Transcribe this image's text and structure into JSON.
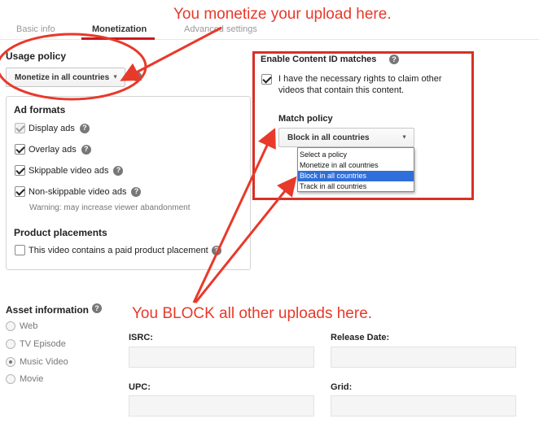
{
  "tabs": [
    {
      "label": "Basic info"
    },
    {
      "label": "Monetization"
    },
    {
      "label": "Advanced settings"
    }
  ],
  "usage_policy": {
    "title": "Usage policy",
    "selected": "Monetize in all countries"
  },
  "ad_formats": {
    "title": "Ad formats",
    "items": [
      {
        "label": "Display ads",
        "checked": true,
        "disabled": true
      },
      {
        "label": "Overlay ads",
        "checked": true
      },
      {
        "label": "Skippable video ads",
        "checked": true
      },
      {
        "label": "Non-skippable video ads",
        "checked": true
      }
    ],
    "warning": "Warning: may increase viewer abandonment"
  },
  "product_placements": {
    "title": "Product placements",
    "checkbox_label": "This video contains a paid product placement",
    "checked": false
  },
  "content_id": {
    "title": "Enable Content ID matches",
    "rights_text": "I have the necessary rights to claim other videos that contain this content.",
    "rights_checked": true,
    "match_policy_title": "Match policy",
    "match_policy_selected": "Block in all countries",
    "options": [
      "Select a policy",
      "Monetize in all countries",
      "Block in all countries",
      "Track in all countries"
    ],
    "highlighted_option": "Block in all countries"
  },
  "asset_info": {
    "title": "Asset information",
    "types": [
      {
        "label": "Web",
        "selected": false
      },
      {
        "label": "TV Episode",
        "selected": false
      },
      {
        "label": "Music Video",
        "selected": true
      },
      {
        "label": "Movie",
        "selected": false
      }
    ],
    "fields": [
      {
        "label": "ISRC:",
        "value": ""
      },
      {
        "label": "Release Date:",
        "value": ""
      },
      {
        "label": "UPC:",
        "value": ""
      },
      {
        "label": "Grid:",
        "value": ""
      }
    ]
  },
  "annotations": {
    "top": "You monetize your upload here.",
    "middle": "You BLOCK all other uploads here."
  },
  "help_icon": "question-mark-icon",
  "colors": {
    "annotation": "#e8392a",
    "tab_accent": "#cc181e",
    "highlight": "#2f6fd9"
  }
}
